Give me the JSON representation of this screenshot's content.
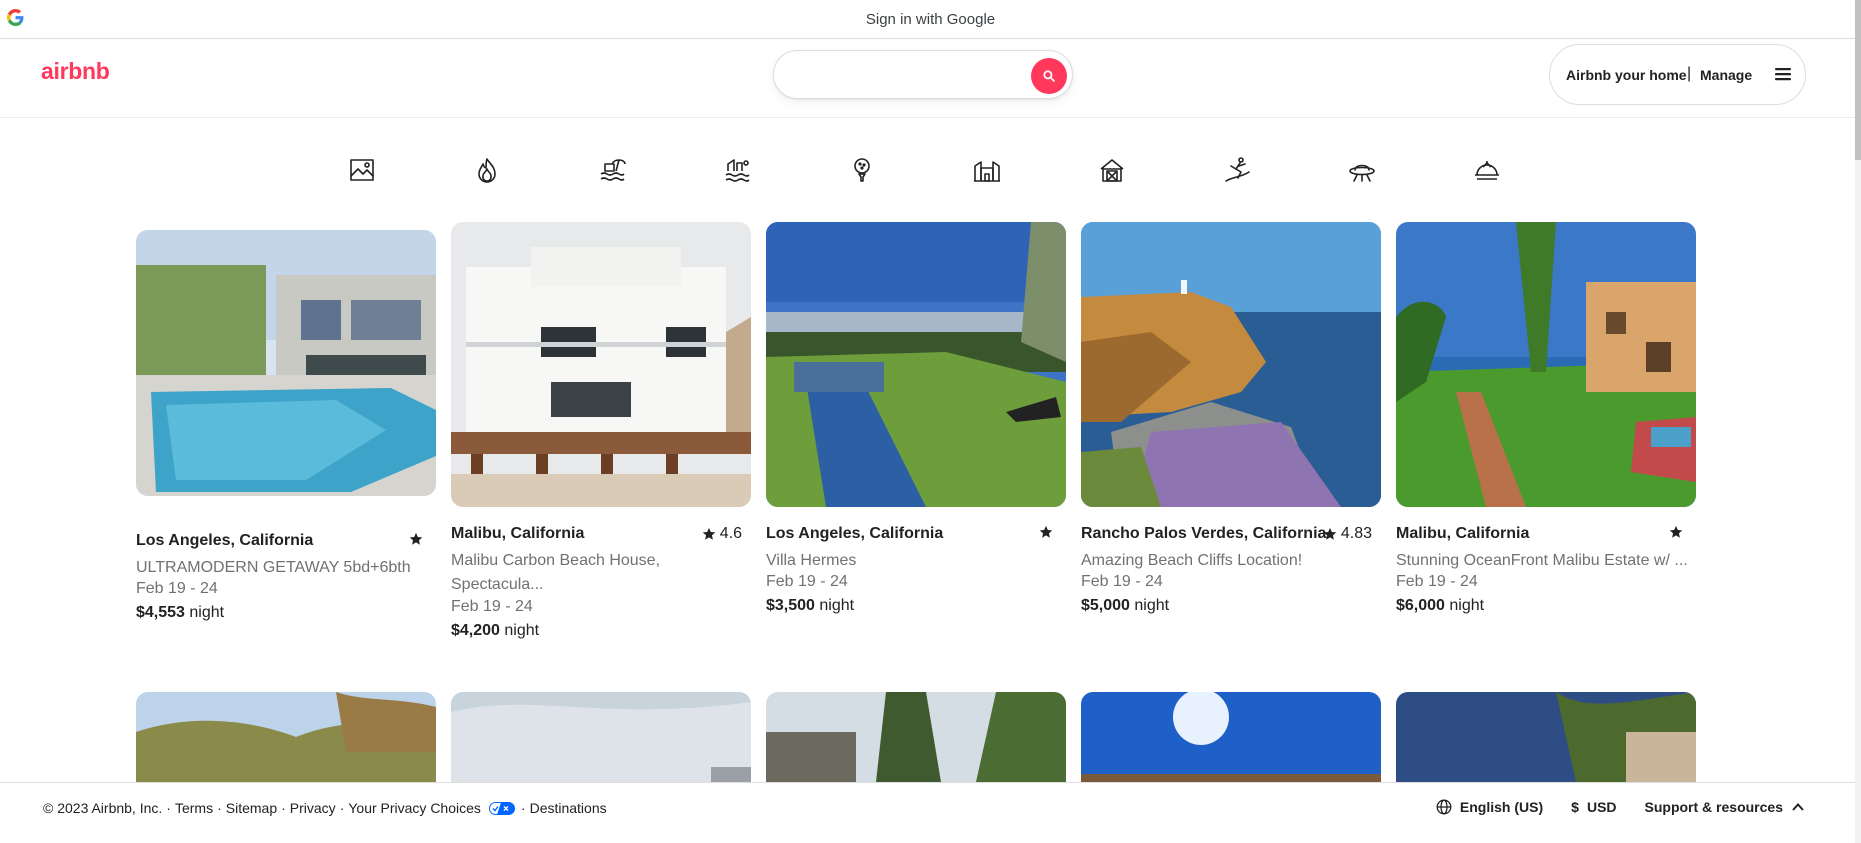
{
  "google_bar": {
    "text": "Sign in with Google"
  },
  "header": {
    "logo": "airbnb",
    "search_placeholder": "",
    "host_label": "Airbnb your home",
    "separator": "|",
    "manage_label": "Manage"
  },
  "categories": [
    "amazing-views-icon",
    "trending-icon",
    "beachfront-icon",
    "lakefront-icon",
    "golfing-icon",
    "mansions-icon",
    "barns-icon",
    "surfing-icon",
    "omg-icon",
    "domes-icon"
  ],
  "listings": [
    {
      "location": "Los Angeles, California",
      "rating": "",
      "title": "ULTRAMODERN GETAWAY 5bd+6bth",
      "title2": "",
      "dates": "Feb 19 - 24",
      "price": "$4,553",
      "unit": " night"
    },
    {
      "location": "Malibu, California",
      "rating": "4.6",
      "title": "Malibu Carbon Beach House,",
      "title2": "Spectacula...",
      "dates": "Feb 19 - 24",
      "price": "$4,200",
      "unit": " night"
    },
    {
      "location": "Los Angeles, California",
      "rating": "",
      "title": "Villa Hermes",
      "title2": "",
      "dates": "Feb 19 - 24",
      "price": "$3,500",
      "unit": " night"
    },
    {
      "location": "Rancho Palos Verdes, California",
      "rating": "4.83",
      "title": "Amazing Beach Cliffs Location!",
      "title2": "",
      "dates": "Feb 19 - 24",
      "price": "$5,000",
      "unit": " night"
    },
    {
      "location": "Malibu, California",
      "rating": "",
      "title": "Stunning OceanFront Malibu Estate w/ ...",
      "title2": "",
      "dates": "Feb 19 - 24",
      "price": "$6,000",
      "unit": " night"
    }
  ],
  "footer": {
    "copyright": "© 2023 Airbnb, Inc.",
    "dot": "·",
    "terms": "Terms",
    "sitemap": "Sitemap",
    "privacy": "Privacy",
    "privacy_choices": "Your Privacy Choices",
    "destinations": "Destinations",
    "language": "English (US)",
    "currency_symbol": "$",
    "currency": "USD",
    "support": "Support & resources"
  },
  "colors": {
    "brand": "#ff385c",
    "muted": "#717171",
    "text": "#222222"
  }
}
